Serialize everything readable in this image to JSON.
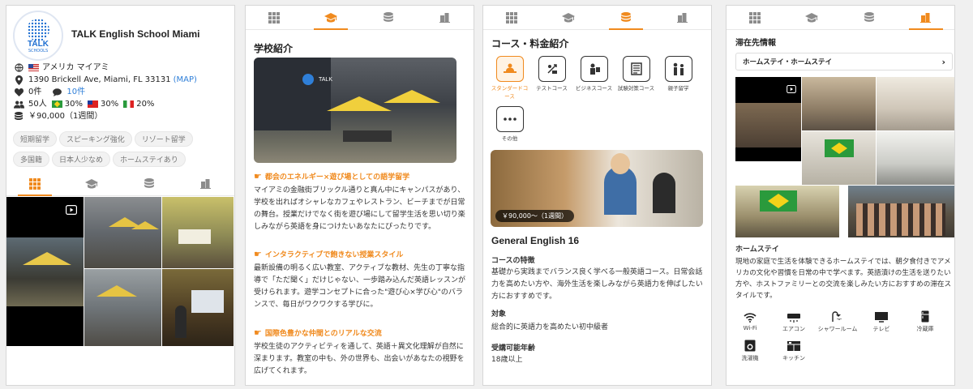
{
  "school": {
    "name": "TALK English School Miami",
    "logo_text_1": "TALK",
    "logo_text_2": "SCHOOLS",
    "country": "アメリカ マイアミ",
    "address": "1390 Brickell Ave, Miami, FL 33131",
    "map_link": "(MAP)",
    "likes": "0件",
    "comments": "10件",
    "students": "50人",
    "nat1": "30%",
    "nat2": "30%",
    "nat3": "20%",
    "price": "￥90,000（1週間）",
    "tags": [
      "短期留学",
      "スピーキング強化",
      "リゾート留学",
      "多国籍",
      "日本人少なめ",
      "ホームステイあり"
    ]
  },
  "tabs": [
    {
      "icon": "grid-icon"
    },
    {
      "icon": "graduation-cap-icon"
    },
    {
      "icon": "coins-icon"
    },
    {
      "icon": "building-icon"
    }
  ],
  "intro": {
    "title": "学校紹介",
    "sections": [
      {
        "heading": "都会のエネルギー×遊び場としての語学留学",
        "text": "マイアミの金融街ブリックル通りと真ん中にキャンパスがあり、学校を出ればオシャレなカフェやレストラン、ビーチまでが日常の舞台。授業だけでなく街を遊び場にして留学生活を思い切り楽しみながら英語を身につけたいあなたにぴったりです。"
      },
      {
        "heading": "インタラクティブで飽きない授業スタイル",
        "text": "最新設備の明るく広い教室、アクティブな教材、先生の丁寧な指導で「ただ聞く」だけじゃない、一歩踏み込んだ英語レッスンが受けられます。遊学コンセプトに合った\"遊び心×学び心\"のバランスで、毎日がワクワクする学びに。"
      },
      {
        "heading": "国際色豊かな仲間とのリアルな交流",
        "text": "学校生徒のアクティビティを通して、英語＋異文化理解が自然に深まります。教室の中も、外の世界も、出会いがあなたの視野を広げてくれます。"
      }
    ]
  },
  "courses": {
    "title": "コース・料金紹介",
    "categories": [
      {
        "label": "スタンダードコース",
        "icon": "standard-course-icon"
      },
      {
        "label": "テストコース",
        "icon": "test-course-icon"
      },
      {
        "label": "ビジネスコース",
        "icon": "business-course-icon"
      },
      {
        "label": "試験対策コース",
        "icon": "exam-course-icon"
      },
      {
        "label": "親子留学",
        "icon": "family-course-icon"
      },
      {
        "label": "その他",
        "icon": "more-icon"
      }
    ],
    "price_badge": "￥90,000～（1週間）",
    "course_name": "General English 16",
    "feature_label": "コースの特徴",
    "feature_text": "基礎から実践までバランス良く学べる一般英語コース。日常会話力を高めたい方や、海外生活を楽しみながら英語力を伸ばしたい方におすすめです。",
    "target_label": "対象",
    "target_text": "総合的に英語力を高めたい初中級者",
    "age_label": "受講可能年齢",
    "age_text": "18歳以上"
  },
  "stay": {
    "title": "滞在先情報",
    "dropdown": "ホームステイ・ホームステイ",
    "section": "ホームステイ",
    "text": "現地の家庭で生活を体験できるホームステイでは、朝夕食付きでアメリカの文化や習慣を日常の中で学べます。英語漬けの生活を送りたい方や、ホストファミリーとの交流を楽しみたい方におすすめの滞在スタイルです。",
    "amenities": [
      {
        "label": "Wi-Fi",
        "icon": "wifi-icon"
      },
      {
        "label": "エアコン",
        "icon": "air-conditioner-icon"
      },
      {
        "label": "シャワールーム",
        "icon": "shower-icon"
      },
      {
        "label": "テレビ",
        "icon": "tv-icon"
      },
      {
        "label": "冷蔵庫",
        "icon": "fridge-icon"
      },
      {
        "label": "洗濯機",
        "icon": "washing-machine-icon"
      },
      {
        "label": "キッチン",
        "icon": "kitchen-icon"
      }
    ]
  },
  "colors": {
    "accent": "#f08a1e",
    "link": "#2f7fd8",
    "logo": "#1f6fd1"
  }
}
